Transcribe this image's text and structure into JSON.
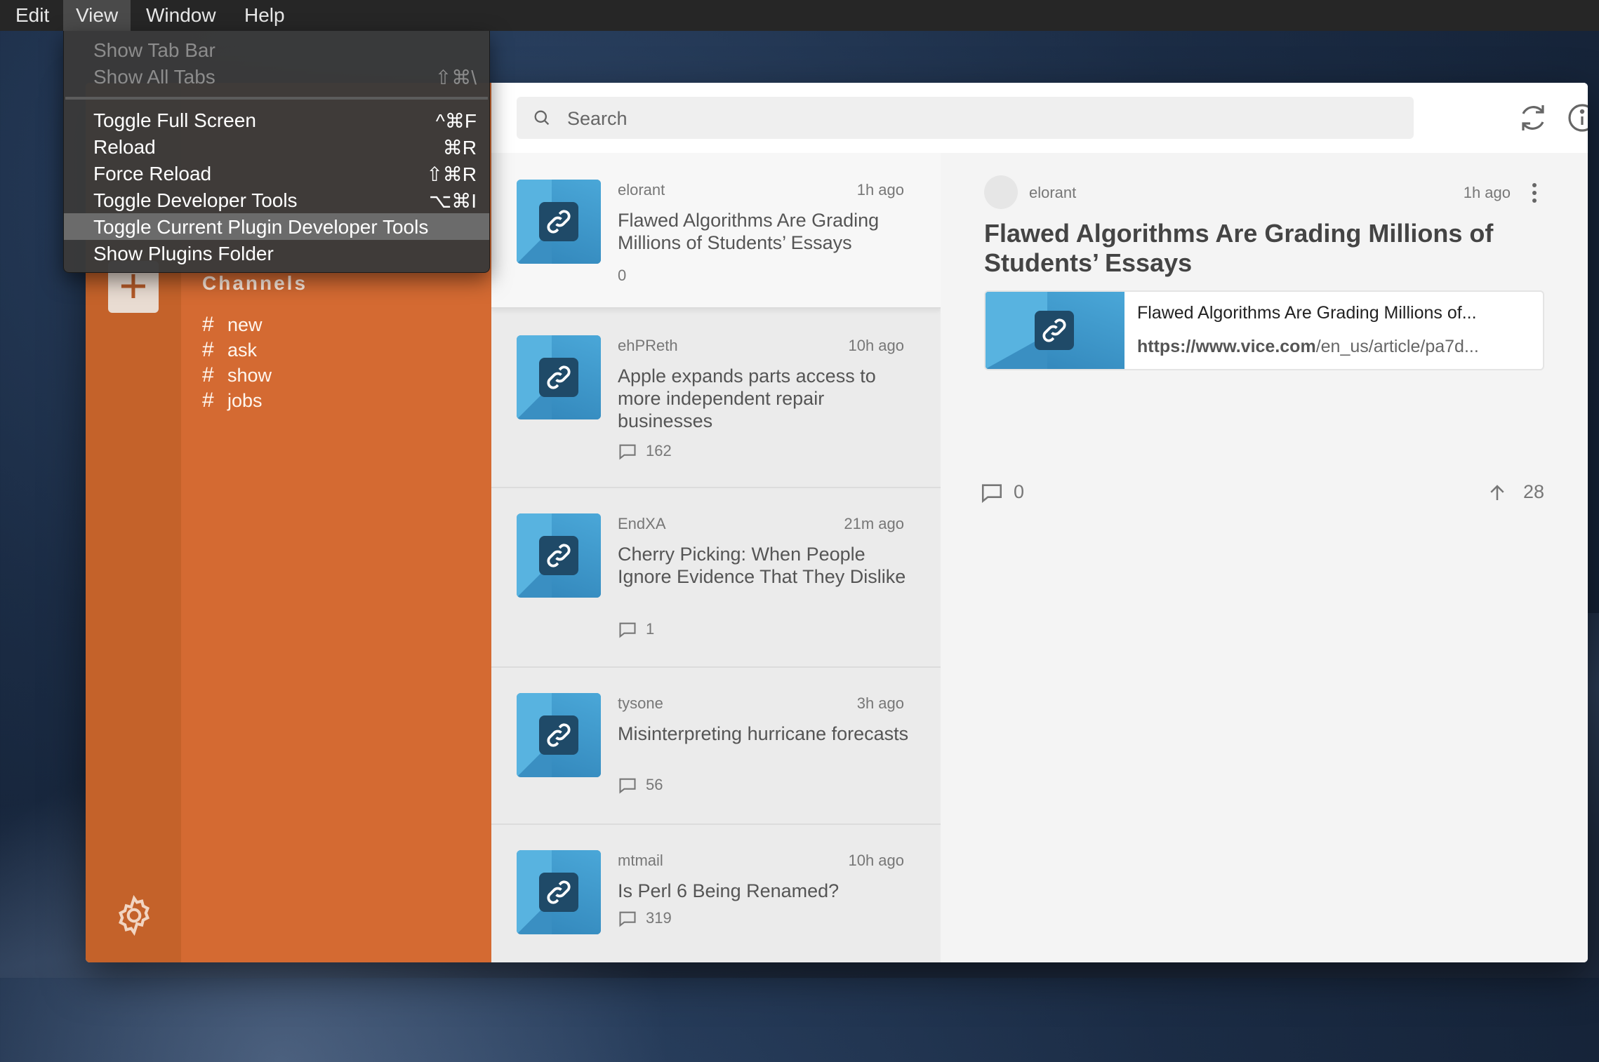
{
  "menubar": {
    "items": [
      "Edit",
      "View",
      "Window",
      "Help"
    ]
  },
  "view_menu": {
    "items": [
      {
        "label": "Show Tab Bar",
        "shortcut": ""
      },
      {
        "label": "Show All Tabs",
        "shortcut": "⇧⌘\\"
      },
      {
        "label": "Toggle Full Screen",
        "shortcut": "^⌘F"
      },
      {
        "label": "Reload",
        "shortcut": "⌘R"
      },
      {
        "label": "Force Reload",
        "shortcut": "⇧⌘R"
      },
      {
        "label": "Toggle Developer Tools",
        "shortcut": "⌥⌘I"
      },
      {
        "label": "Toggle Current Plugin Developer Tools",
        "shortcut": ""
      },
      {
        "label": "Show Plugins Folder",
        "shortcut": ""
      }
    ]
  },
  "sidebar": {
    "add_label": "+",
    "channels_heading": "Channels",
    "channels": [
      {
        "hash": "#",
        "name": "new"
      },
      {
        "hash": "#",
        "name": "ask"
      },
      {
        "hash": "#",
        "name": "show"
      },
      {
        "hash": "#",
        "name": "jobs"
      }
    ],
    "settings_icon": "gear-icon"
  },
  "search": {
    "placeholder": "Search"
  },
  "toolbar_icons": [
    "refresh-icon",
    "info-icon",
    "filter-icon"
  ],
  "posts": [
    {
      "author": "elorant",
      "time": "1h ago",
      "title": "Flawed Algorithms Are Grading Millions of Students’ Essays",
      "comments": "0"
    },
    {
      "author": "ehPReth",
      "time": "10h ago",
      "title": "Apple expands parts access to more independent repair businesses",
      "comments": "162"
    },
    {
      "author": "EndXA",
      "time": "21m ago",
      "title": "Cherry Picking: When People Ignore Evidence That They Dislike",
      "comments": "1"
    },
    {
      "author": "tysone",
      "time": "3h ago",
      "title": "Misinterpreting hurricane forecasts",
      "comments": "56"
    },
    {
      "author": "mtmail",
      "time": "10h ago",
      "title": "Is Perl 6 Being Renamed?",
      "comments": "319"
    }
  ],
  "detail": {
    "author": "elorant",
    "time": "1h ago",
    "title": "Flawed Algorithms Are Grading Millions of Students’ Essays",
    "card_title": "Flawed Algorithms Are Grading Millions of...",
    "card_domain": "https://www.vice.com",
    "card_path": "/en_us/article/pa7d...",
    "comments": "0",
    "votes": "28"
  },
  "colors": {
    "rail": "#c4622a",
    "channels_bg": "#d46a32",
    "thumb": "#3a8fc2"
  }
}
